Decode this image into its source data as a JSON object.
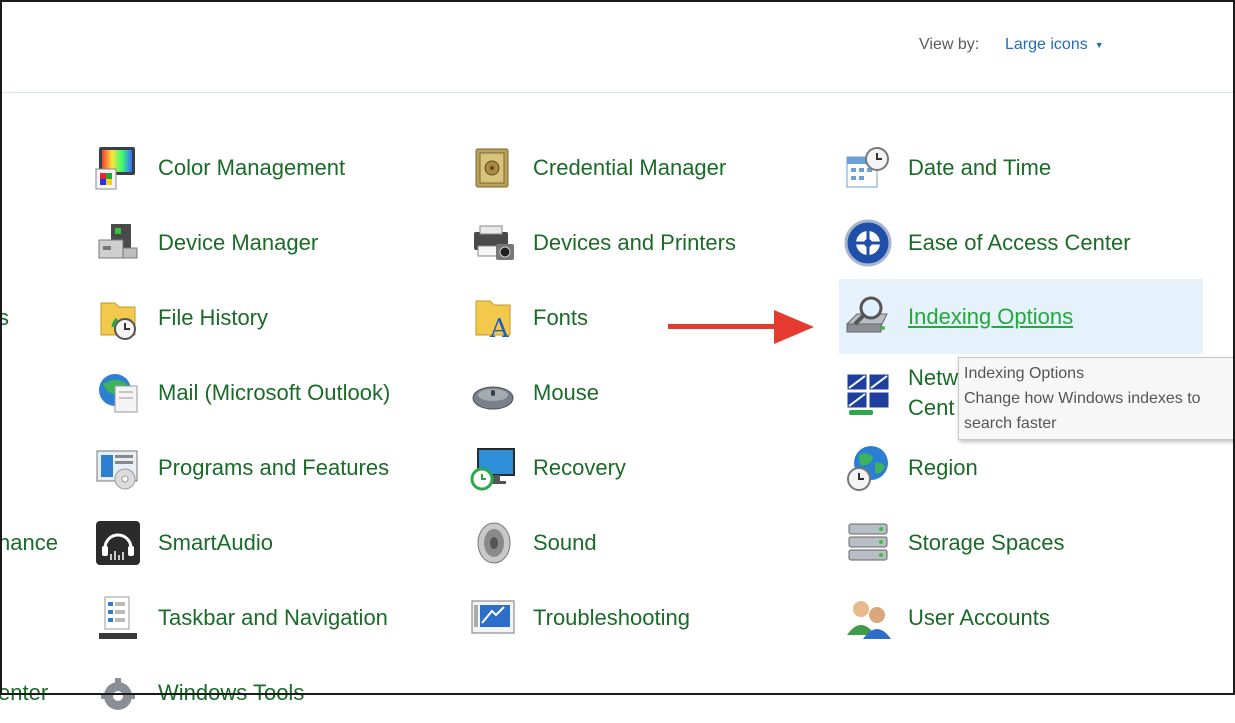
{
  "header": {
    "view_by_label": "View by:",
    "view_by_value": "Large icons"
  },
  "left_partial": {
    "row3": "s",
    "row6": "nance",
    "row8": "enter"
  },
  "columns": {
    "col1": [
      {
        "label": "Color Management",
        "icon": "color-management-icon"
      },
      {
        "label": "Device Manager",
        "icon": "device-manager-icon"
      },
      {
        "label": "File History",
        "icon": "file-history-icon"
      },
      {
        "label": "Mail (Microsoft Outlook)",
        "icon": "mail-icon"
      },
      {
        "label": "Programs and Features",
        "icon": "programs-features-icon"
      },
      {
        "label": "SmartAudio",
        "icon": "smartaudio-icon"
      },
      {
        "label": "Taskbar and Navigation",
        "icon": "taskbar-icon"
      },
      {
        "label": "Windows Tools",
        "icon": "windows-tools-icon"
      }
    ],
    "col2": [
      {
        "label": "Credential Manager",
        "icon": "credential-manager-icon"
      },
      {
        "label": "Devices and Printers",
        "icon": "devices-printers-icon"
      },
      {
        "label": "Fonts",
        "icon": "fonts-icon"
      },
      {
        "label": "Mouse",
        "icon": "mouse-icon"
      },
      {
        "label": "Recovery",
        "icon": "recovery-icon"
      },
      {
        "label": "Sound",
        "icon": "sound-icon"
      },
      {
        "label": "Troubleshooting",
        "icon": "troubleshooting-icon"
      }
    ],
    "col3": [
      {
        "label": "Date and Time",
        "icon": "date-time-icon"
      },
      {
        "label": "Ease of Access Center",
        "icon": "ease-of-access-icon"
      },
      {
        "label": "Indexing Options",
        "icon": "indexing-options-icon"
      },
      {
        "label": "Netw",
        "label2": "Cent",
        "icon": "network-sharing-icon"
      },
      {
        "label": "Region",
        "icon": "region-icon"
      },
      {
        "label": "Storage Spaces",
        "icon": "storage-spaces-icon"
      },
      {
        "label": "User Accounts",
        "icon": "user-accounts-icon"
      }
    ]
  },
  "tooltip": {
    "title": "Indexing Options",
    "line1": "Change how Windows indexes to",
    "line2": "search faster"
  },
  "colors": {
    "link_green": "#1a6b28",
    "hover_green": "#23a93a",
    "highlight_bg": "#e5f1fb",
    "arrow_red": "#e53a2f",
    "viewby_blue": "#1e6cc0"
  }
}
